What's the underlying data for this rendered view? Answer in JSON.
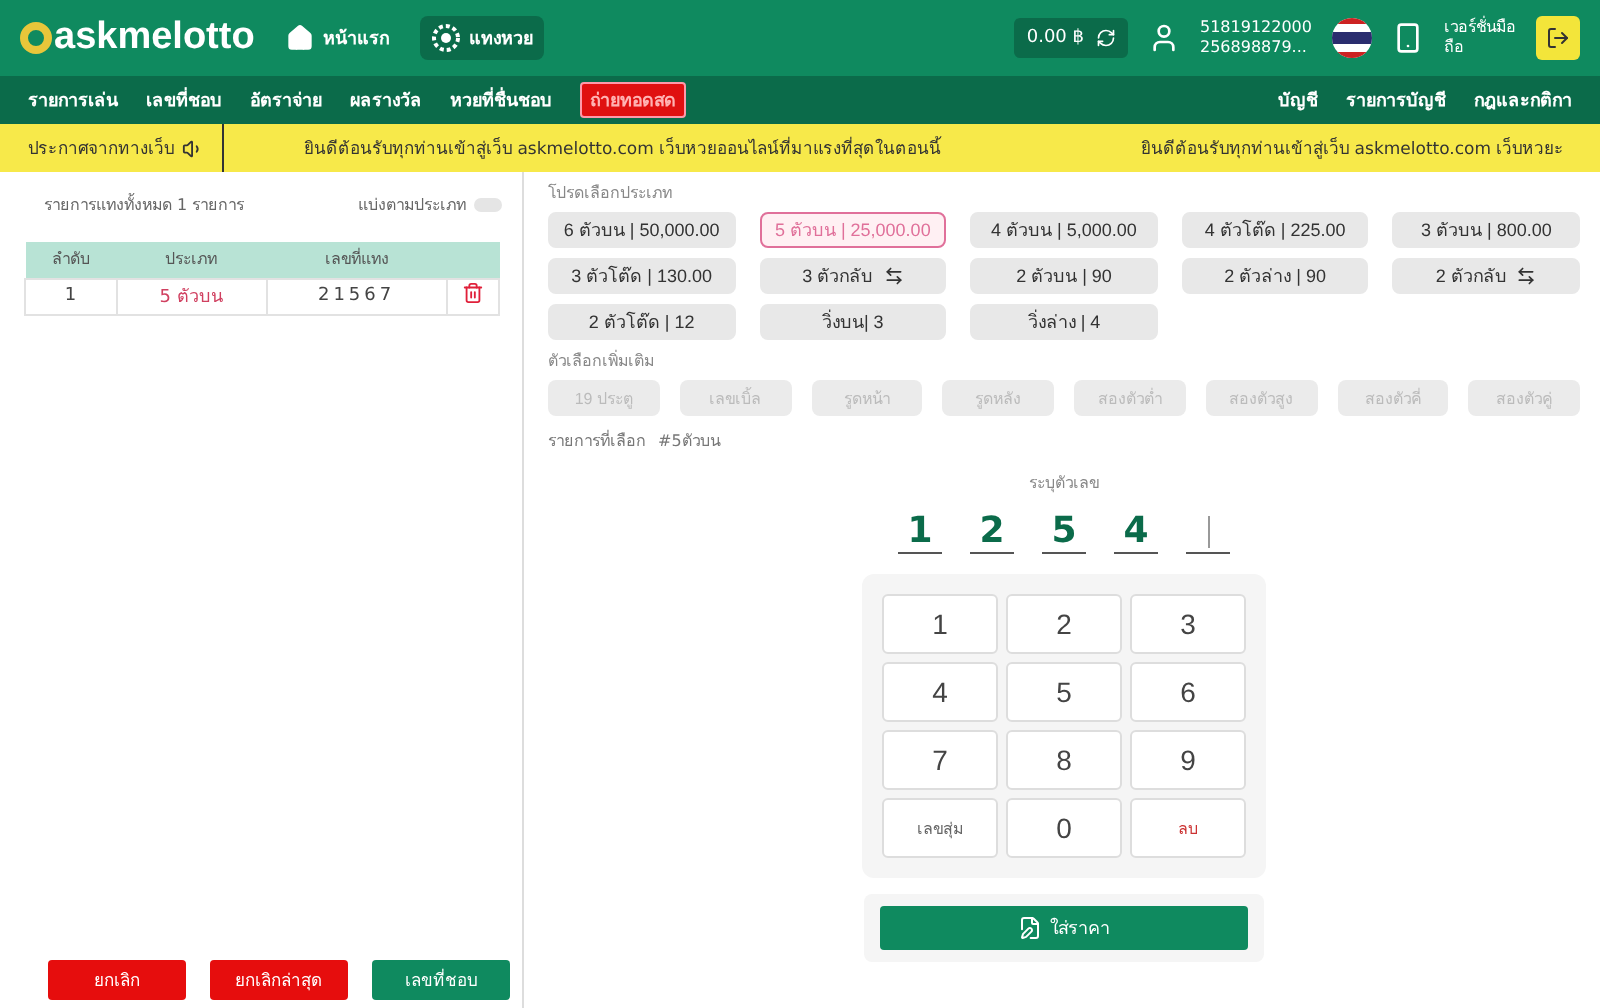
{
  "header": {
    "logo": "askmelotto",
    "home": "หน้าแรก",
    "bet": "แทงหวย",
    "balance": "0.00 ฿",
    "user_id": "51819122000",
    "user_sub": "256898879...",
    "mobile": "เวอร์ชั่นมือถือ"
  },
  "nav": {
    "left": [
      {
        "label": "รายการเล่น",
        "kind": "plain"
      },
      {
        "label": "เลขที่ชอบ",
        "kind": "plain"
      },
      {
        "label": "อัตราจ่าย",
        "kind": "plain"
      },
      {
        "label": "ผลรางวัล",
        "kind": "plain"
      },
      {
        "label": "หวยที่ชื่นชอบ",
        "kind": "plain"
      },
      {
        "label": "ถ่ายทอดสด",
        "kind": "alert"
      }
    ],
    "right": [
      "บัญชี",
      "รายการบัญชี",
      "กฎและกติกา"
    ]
  },
  "announce": {
    "label": "ประกาศจากทางเว็บ",
    "text": "ยินดีต้อนรับทุกท่านเข้าสู่เว็บ askmelotto.com เว็บหวยออนไลน์ที่มาแรงที่สุดในตอนนี้",
    "text_2": "ยินดีต้อนรับทุกท่านเข้าสู่เว็บ askmelotto.com เว็บหวยะ"
  },
  "list": {
    "summary": "รายการแทงทั้งหมด 1 รายการ",
    "split_label": "แบ่งตามประเภท",
    "split_on": false,
    "columns": [
      "ลำดับ",
      "ประเภท",
      "เลขที่แทง"
    ],
    "rows": [
      {
        "no": "1",
        "type": "5 ตัวบน",
        "number": "21567"
      }
    ]
  },
  "actions": [
    "ยกเลิก",
    "ยกเลิกล่าสุด",
    "เลขที่ชอบ"
  ],
  "types": {
    "label": "โปรดเลือกประเภท",
    "items": [
      {
        "label": "6 ตัวบน | 50,000.00",
        "selected": false,
        "swap": false
      },
      {
        "label": "5 ตัวบน | 25,000.00",
        "selected": true,
        "swap": false
      },
      {
        "label": "4 ตัวบน | 5,000.00",
        "selected": false,
        "swap": false
      },
      {
        "label": "4 ตัวโต๊ด | 225.00",
        "selected": false,
        "swap": false
      },
      {
        "label": "3 ตัวบน | 800.00",
        "selected": false,
        "swap": false
      },
      {
        "label": "3 ตัวโต๊ด | 130.00",
        "selected": false,
        "swap": false
      },
      {
        "label": "3 ตัวกลับ",
        "selected": false,
        "swap": true
      },
      {
        "label": "2 ตัวบน | 90",
        "selected": false,
        "swap": false
      },
      {
        "label": "2 ตัวล่าง | 90",
        "selected": false,
        "swap": false
      },
      {
        "label": "2 ตัวกลับ",
        "selected": false,
        "swap": true
      },
      {
        "label": "2 ตัวโต๊ด | 12",
        "selected": false,
        "swap": false
      },
      {
        "label": "วิ่งบน| 3",
        "selected": false,
        "swap": false
      },
      {
        "label": "วิ่งล่าง | 4",
        "selected": false,
        "swap": false
      }
    ]
  },
  "extras": {
    "label": "ตัวเลือกเพิ่มเติม",
    "items": [
      {
        "label": "19 ประตู",
        "disabled": true
      },
      {
        "label": "เลขเบิ้ล",
        "disabled": true
      },
      {
        "label": "รูดหน้า",
        "disabled": true
      },
      {
        "label": "รูดหลัง",
        "disabled": true
      },
      {
        "label": "สองตัวต่ำ",
        "disabled": true
      },
      {
        "label": "สองตัวสูง",
        "disabled": true
      },
      {
        "label": "สองตัวคี่",
        "disabled": true
      },
      {
        "label": "สองตัวคู่",
        "disabled": true
      }
    ]
  },
  "chosen": {
    "label": "รายการที่เลือก",
    "tag": "#5ตัวบน"
  },
  "entry": {
    "label": "ระบุตัวเลข",
    "digits": [
      "1",
      "2",
      "5",
      "4"
    ]
  },
  "keypad": [
    {
      "label": "1",
      "kind": "digit"
    },
    {
      "label": "2",
      "kind": "digit"
    },
    {
      "label": "3",
      "kind": "digit"
    },
    {
      "label": "4",
      "kind": "digit"
    },
    {
      "label": "5",
      "kind": "digit"
    },
    {
      "label": "6",
      "kind": "digit"
    },
    {
      "label": "7",
      "kind": "digit"
    },
    {
      "label": "8",
      "kind": "digit"
    },
    {
      "label": "9",
      "kind": "digit"
    },
    {
      "label": "เลขสุ่ม",
      "kind": "random"
    },
    {
      "label": "0",
      "kind": "digit"
    },
    {
      "label": "ลบ",
      "kind": "delete"
    }
  ],
  "submit": "ใส่ราคา"
}
